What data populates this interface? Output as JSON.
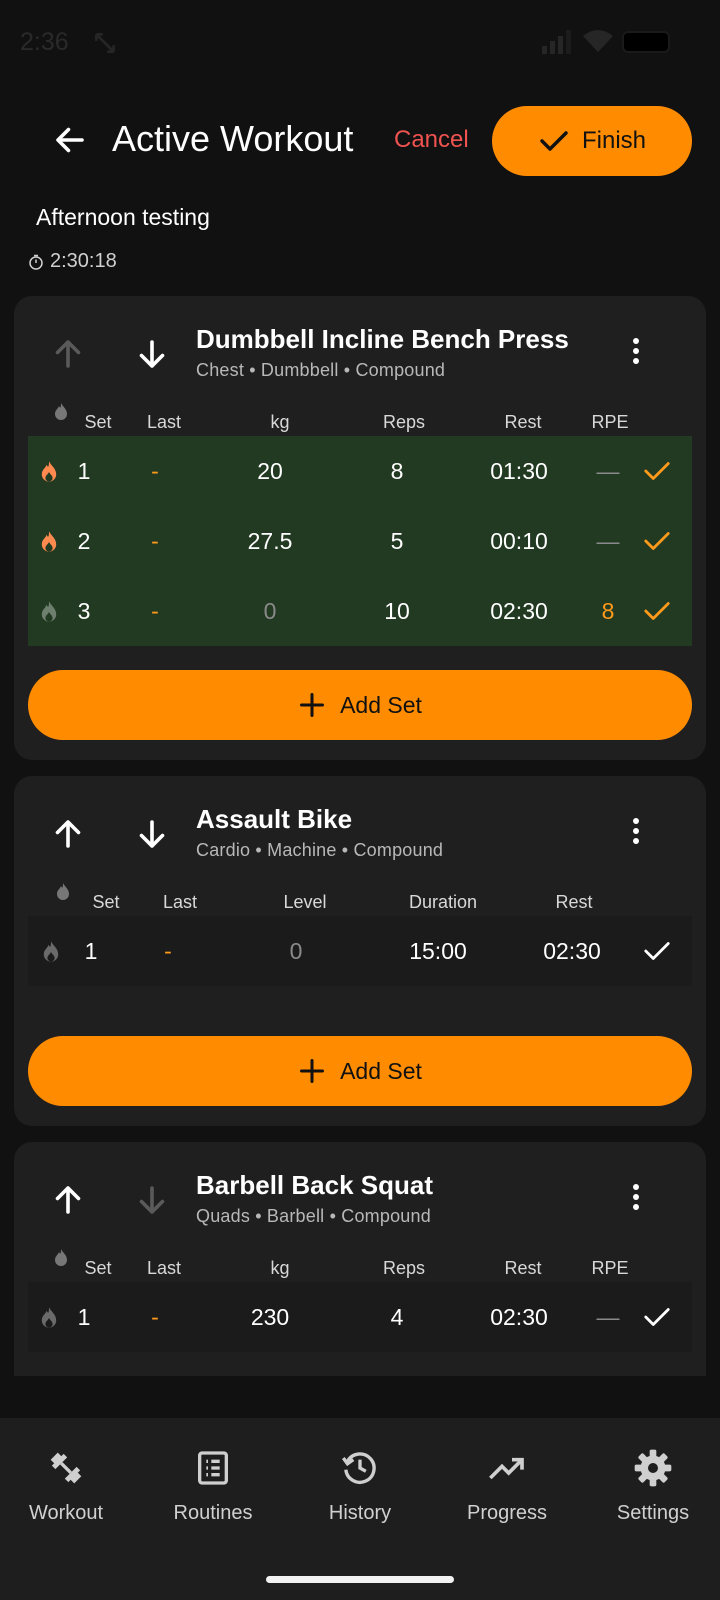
{
  "status_bar": {
    "time": "2:36"
  },
  "header": {
    "title": "Active Workout",
    "cancel_label": "Cancel",
    "finish_label": "Finish"
  },
  "workout": {
    "name": "Afternoon testing",
    "elapsed": "2:30:18"
  },
  "exercises": [
    {
      "name": "Dumbbell Incline Bench Press",
      "subtitle": "Chest • Dumbbell • Compound",
      "move_up_enabled": false,
      "move_down_enabled": true,
      "columns": [
        "Set",
        "Last",
        "kg",
        "Reps",
        "Rest",
        "RPE"
      ],
      "sets": [
        {
          "set": "1",
          "last": "-",
          "kg": "20",
          "reps": "8",
          "rest": "01:30",
          "rpe": "—",
          "warmup": true,
          "completed": true
        },
        {
          "set": "2",
          "last": "-",
          "kg": "27.5",
          "reps": "5",
          "rest": "00:10",
          "rpe": "—",
          "warmup": true,
          "completed": true
        },
        {
          "set": "3",
          "last": "-",
          "kg": "0",
          "reps": "10",
          "rest": "02:30",
          "rpe": "8",
          "warmup": false,
          "completed": true
        }
      ],
      "add_set_label": "Add Set"
    },
    {
      "name": "Assault Bike",
      "subtitle": "Cardio • Machine • Compound",
      "move_up_enabled": true,
      "move_down_enabled": true,
      "columns": [
        "Set",
        "Last",
        "Level",
        "Duration",
        "Rest"
      ],
      "sets": [
        {
          "set": "1",
          "last": "-",
          "level": "0",
          "duration": "15:00",
          "rest": "02:30",
          "warmup": false,
          "completed": false
        }
      ],
      "add_set_label": "Add Set"
    },
    {
      "name": "Barbell Back Squat",
      "subtitle": "Quads • Barbell • Compound",
      "move_up_enabled": true,
      "move_down_enabled": false,
      "columns": [
        "Set",
        "Last",
        "kg",
        "Reps",
        "Rest",
        "RPE"
      ],
      "sets": [
        {
          "set": "1",
          "last": "-",
          "kg": "230",
          "reps": "4",
          "rest": "02:30",
          "rpe": "—",
          "warmup": false,
          "completed": false
        }
      ]
    }
  ],
  "bottom_nav": [
    {
      "label": "Workout",
      "icon": "dumbbell-icon"
    },
    {
      "label": "Routines",
      "icon": "list-icon"
    },
    {
      "label": "History",
      "icon": "history-icon"
    },
    {
      "label": "Progress",
      "icon": "trending-up-icon"
    },
    {
      "label": "Settings",
      "icon": "gear-icon"
    }
  ],
  "colors": {
    "accent": "#ff8c00",
    "cancel": "#ef5350",
    "completed_row": "#223a22",
    "card": "#1f1f1f",
    "background": "#111111"
  }
}
